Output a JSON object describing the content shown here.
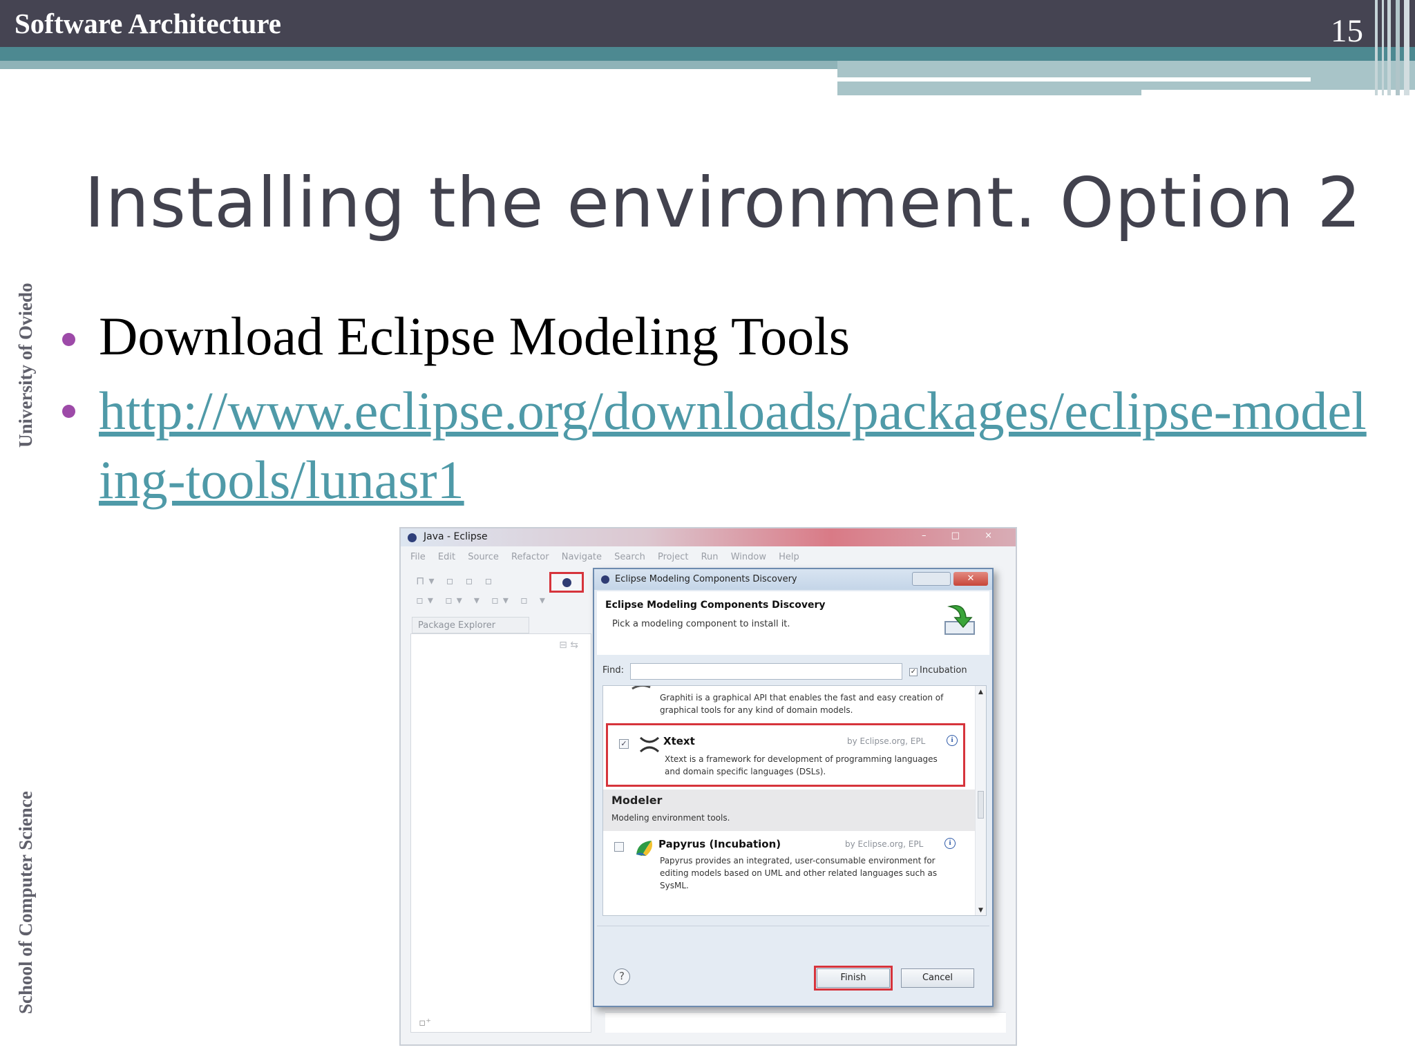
{
  "header": {
    "course_title": "Software Architecture",
    "page_number": "15"
  },
  "side_labels": {
    "university": "University of Oviedo",
    "school": "School of Computer Science"
  },
  "slide": {
    "title": "Installing the environment. Option 2",
    "bullets": [
      {
        "text": "Download Eclipse Modeling Tools",
        "is_link": false
      },
      {
        "text": "http://www.eclipse.org/downloads/packages/eclipse-modeling-tools/lunasr1",
        "is_link": true
      }
    ],
    "bullet_color": "#9d4aa8",
    "link_color": "#4f9aa8"
  },
  "eclipse": {
    "window_title": "Java - Eclipse",
    "window_controls": "– □ ×",
    "menu": [
      "File",
      "Edit",
      "Source",
      "Refactor",
      "Navigate",
      "Search",
      "Project",
      "Run",
      "Window",
      "Help"
    ],
    "package_explorer_tab": "Package Explorer",
    "dialog": {
      "window_title": "Eclipse Modeling Components Discovery",
      "header_title": "Eclipse Modeling Components Discovery",
      "header_subtitle": "Pick a modeling component to install it.",
      "find_label": "Find:",
      "find_value": "",
      "incubation_label": "Incubation",
      "incubation_checked": true,
      "graphiti_desc": "Graphiti is a graphical API that enables the fast and easy creation of graphical tools for any kind of domain models.",
      "items": [
        {
          "name": "Xtext",
          "provider": "by Eclipse.org, EPL",
          "checked": true,
          "description": "Xtext is a framework for development of programming languages and domain specific languages (DSLs)."
        },
        {
          "name": "Papyrus (Incubation)",
          "provider": "by Eclipse.org, EPL",
          "checked": false,
          "description": "Papyrus provides an integrated, user-consumable environment for editing models based on UML and other related languages such as SysML."
        }
      ],
      "category": {
        "name": "Modeler",
        "description": "Modeling environment tools."
      },
      "finish_label": "Finish",
      "cancel_label": "Cancel",
      "help_glyph": "?"
    }
  }
}
